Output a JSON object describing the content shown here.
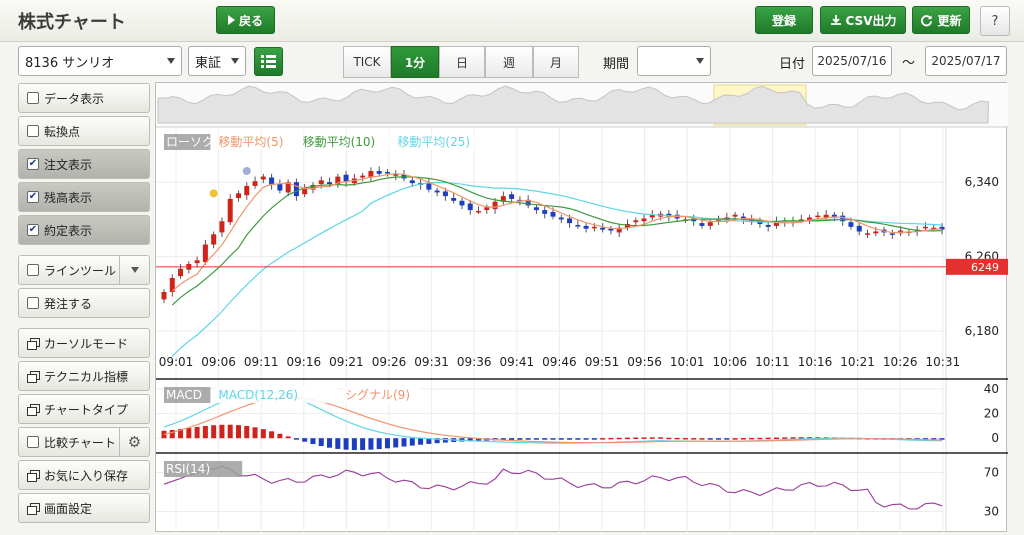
{
  "header": {
    "title": "株式チャート",
    "back_label": "戻る",
    "register_label": "登録",
    "csv_label": "CSV出力",
    "refresh_label": "更新",
    "help_label": "?"
  },
  "toolbar": {
    "symbol": "8136 サンリオ",
    "market": "東証",
    "intervals": [
      {
        "label": "TICK",
        "active": false
      },
      {
        "label": "1分",
        "active": true
      },
      {
        "label": "日",
        "active": false
      },
      {
        "label": "週",
        "active": false
      },
      {
        "label": "月",
        "active": false
      }
    ],
    "period_label": "期間",
    "period_value": "",
    "date_label": "日付",
    "date_from": "2025/07/16",
    "date_sep": "～",
    "date_to": "2025/07/17"
  },
  "sidebar": {
    "items": [
      {
        "label": "データ表示",
        "type": "check",
        "checked": false
      },
      {
        "label": "転換点",
        "type": "check",
        "checked": false
      },
      {
        "label": "注文表示",
        "type": "check",
        "checked": true
      },
      {
        "label": "残高表示",
        "type": "check",
        "checked": true
      },
      {
        "label": "約定表示",
        "type": "check",
        "checked": true
      },
      {
        "label": "ラインツール",
        "type": "check-dropdown",
        "checked": false
      },
      {
        "label": "発注する",
        "type": "check",
        "checked": false
      },
      {
        "label": "カーソルモード",
        "type": "window"
      },
      {
        "label": "テクニカル指標",
        "type": "window"
      },
      {
        "label": "チャートタイプ",
        "type": "window"
      },
      {
        "label": "比較チャート",
        "type": "check-gear",
        "checked": false
      },
      {
        "label": "お気に入り保存",
        "type": "window"
      },
      {
        "label": "画面設定",
        "type": "window"
      }
    ]
  },
  "colors": {
    "up": "#d0231b",
    "down": "#1c3ec0",
    "ma5": "#f0956a",
    "ma10": "#3f9a3f",
    "ma25": "#5ed6e6",
    "rsi": "#9a3b9a",
    "price_line": "#e53030"
  },
  "chart_data": [
    {
      "type": "candlestick",
      "legend": [
        {
          "label": "ローソク",
          "color": "#9e9e9e",
          "text": "#ffffff"
        },
        {
          "label": "移動平均(5)",
          "color": "#ffffff",
          "text": "#f0956a"
        },
        {
          "label": "移動平均(10)",
          "color": "#ffffff",
          "text": "#3f9a3f"
        },
        {
          "label": "移動平均(25)",
          "color": "#ffffff",
          "text": "#5ed6e6"
        }
      ],
      "x_ticks": [
        "09:01",
        "09:06",
        "09:11",
        "09:16",
        "09:21",
        "09:26",
        "09:31",
        "09:36",
        "09:41",
        "09:46",
        "09:51",
        "09:56",
        "10:01",
        "10:06",
        "10:11",
        "10:16",
        "10:21",
        "10:26",
        "10:31"
      ],
      "y_ticks": [
        {
          "value": 6340,
          "label": "6,340"
        },
        {
          "value": 6260,
          "label": "6,260"
        },
        {
          "value": 6180,
          "label": "6,180"
        }
      ],
      "ylim": [
        6165,
        6395
      ],
      "current_price": {
        "value": 6249,
        "label": "6249"
      },
      "closes": [
        6222,
        6237,
        6247,
        6252,
        6256,
        6273,
        6284,
        6298,
        6322,
        6328,
        6336,
        6341,
        6346,
        6337,
        6331,
        6340,
        6325,
        6333,
        6337,
        6342,
        6338,
        6346,
        6340,
        6344,
        6347,
        6352,
        6349,
        6350,
        6347,
        6344,
        6339,
        6337,
        6332,
        6329,
        6325,
        6320,
        6315,
        6310,
        6309,
        6313,
        6319,
        6325,
        6322,
        6320,
        6315,
        6310,
        6306,
        6303,
        6300,
        6296,
        6293,
        6290,
        6292,
        6289,
        6288,
        6291,
        6295,
        6299,
        6301,
        6305,
        6306,
        6303,
        6301,
        6300,
        6298,
        6293,
        6297,
        6300,
        6302,
        6305,
        6300,
        6297,
        6295,
        6292,
        6298,
        6299,
        6297,
        6300,
        6302,
        6304,
        6305,
        6302,
        6298,
        6292,
        6287,
        6285,
        6287,
        6286,
        6284,
        6288,
        6287,
        6289,
        6292,
        6291,
        6289
      ]
    },
    {
      "type": "line",
      "title": "MACD",
      "legend": [
        {
          "label": "MACD",
          "color": "#9e9e9e",
          "text": "#ffffff"
        },
        {
          "label": "MACD(12,26)",
          "color": "#ffffff",
          "text": "#5ed6e6"
        },
        {
          "label": "シグナル(9)",
          "color": "#ffffff",
          "text": "#f0956a"
        }
      ],
      "y_ticks": [
        40,
        20,
        0
      ],
      "ylim": [
        -12,
        48
      ]
    },
    {
      "type": "line",
      "title": "RSI",
      "legend": [
        {
          "label": "RSI(14)",
          "color": "#9e9e9e",
          "text": "#ffffff"
        }
      ],
      "y_ticks": [
        70,
        30
      ],
      "ylim": [
        10,
        90
      ]
    }
  ]
}
